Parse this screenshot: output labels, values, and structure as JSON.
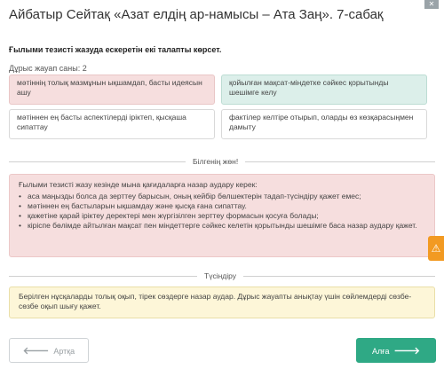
{
  "header": {
    "title": "Айбатыр Сейтақ «Азат елдің ар-намысы – Ата Заң». 7-сабақ",
    "close_label": "✕"
  },
  "question": {
    "text": "Ғылыми тезисті жазуда ескеретін екі талапты көрсет.",
    "answers_count": "Дұрыс жауап саны: 2"
  },
  "options": [
    {
      "text": "мәтіннің толық мазмұнын ықшамдап, басты идеясын ашу",
      "state": "wrong"
    },
    {
      "text": "қойылған мақсат-міндетке сәйкес қорытынды шешімге келу",
      "state": "correct"
    },
    {
      "text": "мәтіннен ең басты аспектілерді іріктеп, қысқаша сипаттау",
      "state": "neutral"
    },
    {
      "text": "фактілер келтіре отырып, оларды өз көзқарасыңмен дамыту",
      "state": "neutral"
    }
  ],
  "know_section": {
    "divider_label": "Білгенің жөн!",
    "heading": "Ғылыми тезисті жазу кезінде мына қағидаларға назар аудару керек:",
    "items": [
      "аса маңызды болса да зерттеу барысын, оның кейбір бөлшектерін тадап-түсіндіру қажет емес;",
      "мәтіннен ең бастыларын ықшамдау және қысқа ғана сипаттау.",
      "қажетіне қарай іріктеу деректері мен жүргізілген зерттеу формасын қосуға болады;",
      "кіріспе бөлімде айтылған мақсат пен міндеттерге сәйкес келетін қорытынды шешімге баса назар аудару қажет."
    ]
  },
  "explain_section": {
    "divider_label": "Түсіндіру",
    "text": "Берілген нұсқаларды толық оқып, тірек сөздерге назар аудар. Дұрыс жауапты анықтау үшін сөйлемдерді сөзбе-сөзбе оқып шығу қажет."
  },
  "navigation": {
    "back_label": "Артқа",
    "next_label": "Алға"
  },
  "colors": {
    "wrong_bg": "#f6dede",
    "correct_bg": "#dcefea",
    "explain_bg": "#fdf6d8",
    "accent_green": "#2fa985",
    "warning_orange": "#f29a22"
  },
  "icons": {
    "back": "arrow-left-icon",
    "next": "arrow-right-icon",
    "warning": "warning-icon",
    "close": "close-icon"
  }
}
